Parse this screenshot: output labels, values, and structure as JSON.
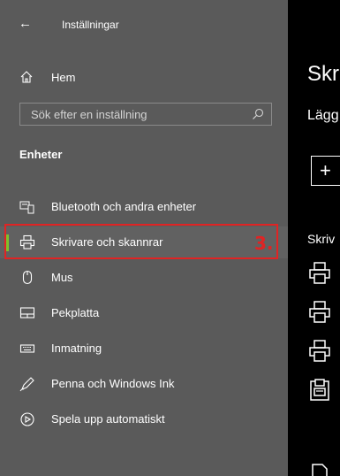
{
  "app": {
    "title": "Inställningar",
    "back_icon": "back-arrow-icon"
  },
  "sidebar": {
    "home_label": "Hem",
    "search_placeholder": "Sök efter en inställning",
    "section_title": "Enheter",
    "items": [
      {
        "label": "Bluetooth och andra enheter",
        "icon": "bluetooth-device-icon"
      },
      {
        "label": "Skrivare och skannrar",
        "icon": "printer-icon",
        "selected": true
      },
      {
        "label": "Mus",
        "icon": "mouse-icon"
      },
      {
        "label": "Pekplatta",
        "icon": "touchpad-icon"
      },
      {
        "label": "Inmatning",
        "icon": "keyboard-icon"
      },
      {
        "label": "Penna och Windows Ink",
        "icon": "pen-icon"
      },
      {
        "label": "Spela upp automatiskt",
        "icon": "autoplay-icon"
      }
    ]
  },
  "annotation": {
    "step_label": "3.",
    "color": "#e02424"
  },
  "main": {
    "title_partial": "Skr",
    "add_heading_partial": "Lägg",
    "add_button_symbol": "+",
    "list_heading_partial": "Skriv",
    "printer_icon_count": 5
  },
  "colors": {
    "sidebar_bg": "#5a5a5a",
    "main_bg": "#000000",
    "accent": "#7cc22c"
  }
}
